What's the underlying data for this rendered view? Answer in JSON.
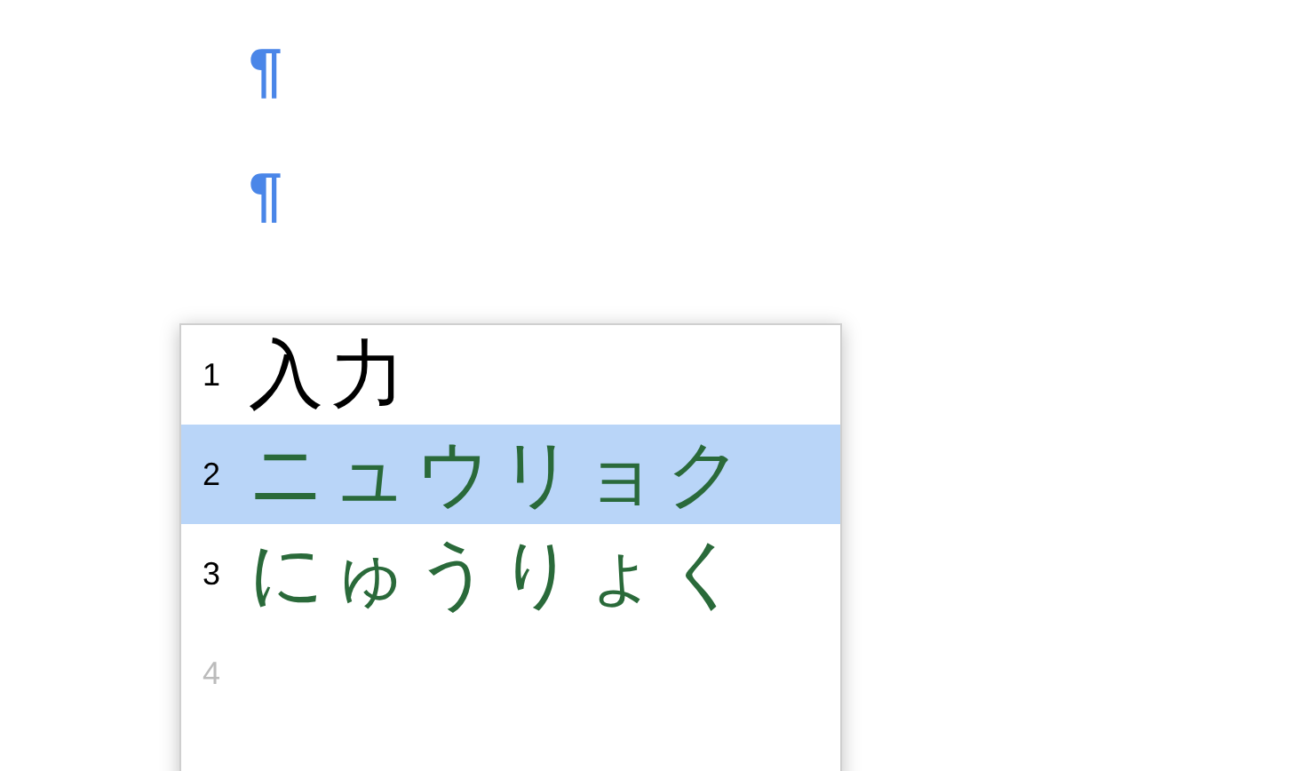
{
  "paragraph_marks": [
    "¶",
    "¶"
  ],
  "candidates": [
    {
      "number": "1",
      "text": "入力",
      "selected": false,
      "color": "#000000"
    },
    {
      "number": "2",
      "text": "ニュウリョク",
      "selected": true,
      "color": "#2a6a3a"
    },
    {
      "number": "3",
      "text": "にゅうりょく",
      "selected": false,
      "color": "#2a6a3a"
    },
    {
      "number": "4",
      "disabled": true,
      "selected": false
    }
  ]
}
